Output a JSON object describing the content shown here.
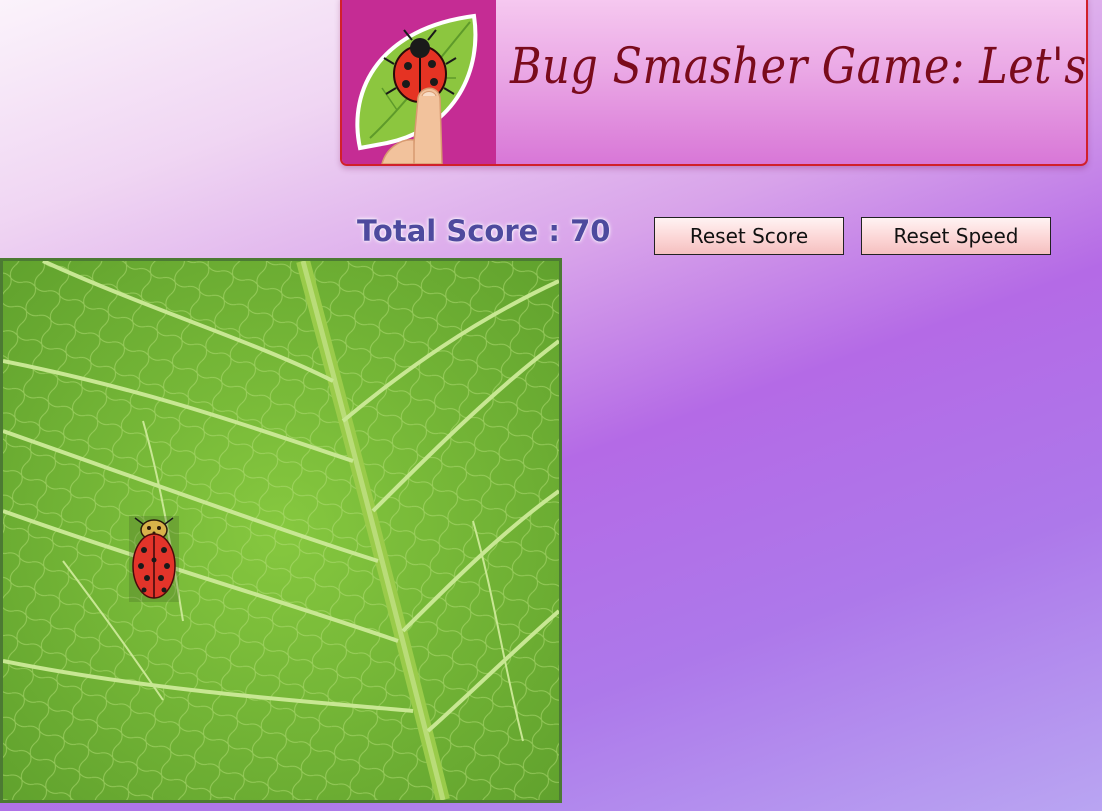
{
  "header": {
    "title": "Bug Smasher Game: Let's Play",
    "logo_icon": "ladybug-leaf-finger-logo"
  },
  "score": {
    "label": "Total Score :",
    "value": "70"
  },
  "buttons": {
    "reset_score": "Reset Score",
    "reset_speed": "Reset Speed"
  },
  "game": {
    "background": "green-leaf",
    "bug_icon": "ladybug-icon"
  },
  "colors": {
    "title": "#7a0b1c",
    "score_text": "#4e4a9e",
    "banner_border": "#d1202a",
    "logo_bg": "#c52c94",
    "leaf_green": "#6fb236"
  }
}
